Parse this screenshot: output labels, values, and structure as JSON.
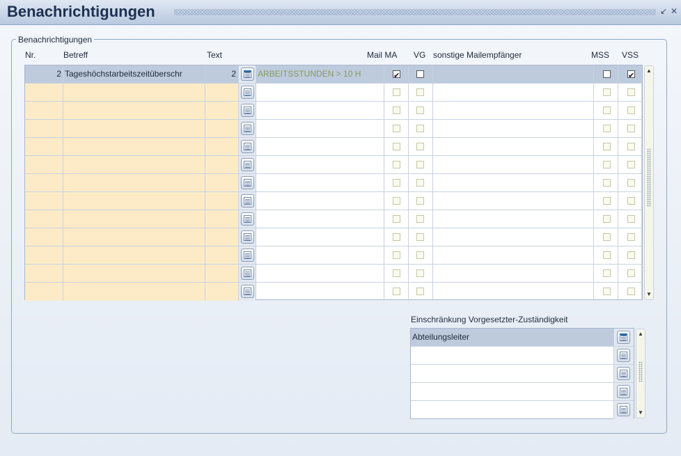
{
  "window": {
    "title": "Benachrichtigungen",
    "minimize_icon": "minimize-arrow-icon",
    "close_icon": "close-icon"
  },
  "group": {
    "title": "Benachrichtigungen"
  },
  "columns": {
    "nr": "Nr.",
    "betreff": "Betreff",
    "text": "Text",
    "mail_ma": "Mail MA",
    "vg": "VG",
    "sonstige": "sonstige Mailempfänger",
    "mss": "MSS",
    "vss": "VSS"
  },
  "rows": [
    {
      "nr": "2",
      "betreff": "Tageshöchstarbeitszeitüberschr",
      "text_nr": "2",
      "text_desc": "ARBEITSSTUNDEN > 10 H",
      "mail_ma": true,
      "vg": false,
      "sonstige": "",
      "mss": false,
      "vss": true
    }
  ],
  "empty_row_count": 12,
  "restriction": {
    "label": "Einschränkung Vorgesetzter-Zuständigkeit",
    "rows": [
      "Abteilungsleiter",
      "",
      "",
      "",
      ""
    ]
  },
  "colors": {
    "accent": "#bdcbdd",
    "field_yellow": "#fdebc8",
    "text_desc": "#8a9a5a"
  }
}
